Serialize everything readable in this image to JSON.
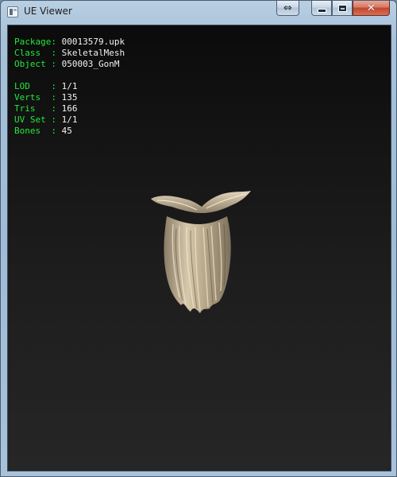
{
  "window": {
    "title": "UE Viewer",
    "swap_icon": "double-arrow-icon",
    "minimize_icon": "minimize-icon",
    "maximize_icon": "maximize-icon",
    "close_icon": "close-icon"
  },
  "info_top": [
    {
      "label": "Package:",
      "value": "00013579.upk"
    },
    {
      "label": "Class  :",
      "value": "SkeletalMesh"
    },
    {
      "label": "Object :",
      "value": "050003_GonM"
    }
  ],
  "info_stats": [
    {
      "label": "LOD    :",
      "value": "1/1"
    },
    {
      "label": "Verts  :",
      "value": "135"
    },
    {
      "label": "Tris   :",
      "value": "166"
    },
    {
      "label": "UV Set :",
      "value": "1/1"
    },
    {
      "label": "Bones  :",
      "value": "45"
    }
  ],
  "colors": {
    "label": "#22e83a",
    "value": "#f2f2f2",
    "mesh": "#c8b89a"
  },
  "viewport": {
    "model": "beard-mesh"
  }
}
